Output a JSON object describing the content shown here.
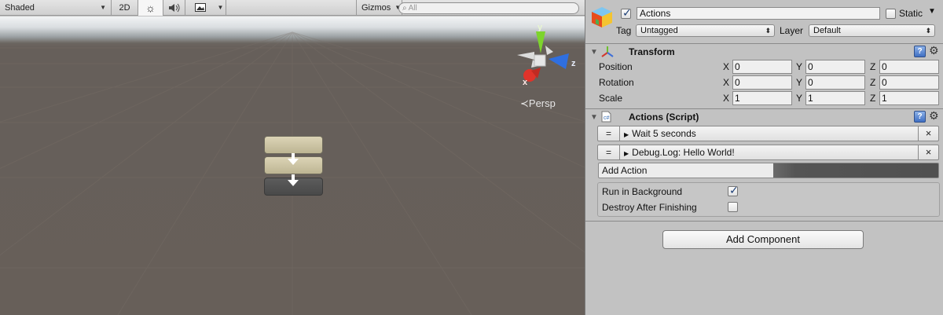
{
  "scene": {
    "shading_mode": "Shaded",
    "mode_2d": "2D",
    "gizmos_label": "Gizmos",
    "search_placeholder": "All",
    "persp_label": "Persp",
    "axis_y": "y",
    "axis_z": "z",
    "axis_x": "x",
    "colors": {
      "ground": "#675f59",
      "action_box_fill": "#cfc7a6",
      "action_box_dark": "#535353",
      "gizmo_y": "#7dd42c",
      "gizmo_z": "#2f6fe0",
      "gizmo_x": "#e0332a"
    }
  },
  "inspector": {
    "object_name": "Actions",
    "active_checked": true,
    "static_label": "Static",
    "tag_label": "Tag",
    "tag_value": "Untagged",
    "layer_label": "Layer",
    "layer_value": "Default",
    "transform": {
      "title": "Transform",
      "position_label": "Position",
      "rotation_label": "Rotation",
      "scale_label": "Scale",
      "position": {
        "x": "0",
        "y": "0",
        "z": "0"
      },
      "rotation": {
        "x": "0",
        "y": "0",
        "z": "0"
      },
      "scale": {
        "x": "1",
        "y": "1",
        "z": "1"
      },
      "axis_x": "X",
      "axis_y": "Y",
      "axis_z": "Z"
    },
    "script": {
      "title": "Actions (Script)",
      "actions": [
        {
          "handle": "=",
          "label": "Wait 5 seconds",
          "remove": "×"
        },
        {
          "handle": "=",
          "label": "Debug.Log: Hello World!",
          "remove": "×"
        }
      ],
      "add_action_label": "Add Action",
      "run_in_background_label": "Run in Background",
      "run_in_background_checked": true,
      "destroy_after_finishing_label": "Destroy After Finishing",
      "destroy_after_finishing_checked": false
    },
    "add_component_label": "Add Component"
  }
}
